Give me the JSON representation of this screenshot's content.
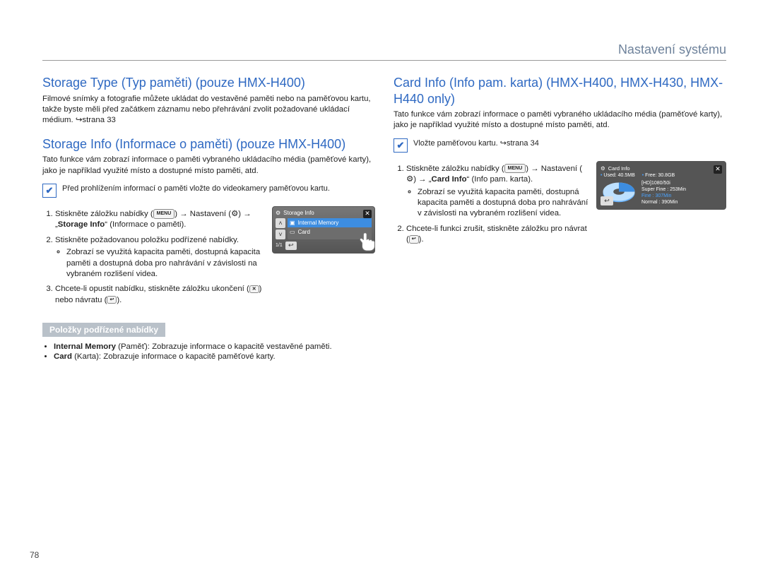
{
  "page_header": "Nastavení systému",
  "page_number": "78",
  "left": {
    "h_storage_type": "Storage Type (Typ paměti) (pouze HMX-H400)",
    "p_storage_type": "Filmové snímky a fotografie můžete ukládat do vestavěné paměti nebo na paměťovou kartu, takže byste měli před začátkem záznamu nebo přehrávání zvolit požadované ukládací médium. ↪strana 33",
    "h_storage_info": "Storage Info (Informace o paměti) (pouze HMX-H400)",
    "p_storage_info": "Tato funkce vám zobrazí informace o paměti vybraného ukládacího média (paměťové karty), jako je například využité místo a dostupné místo paměti, atd.",
    "note": "Před prohlížením informací o paměti vložte do videokamery paměťovou kartu.",
    "step1_a": "Stiskněte záložku nabídky (",
    "step1_b": ") → Nastavení (",
    "step1_c": ") → „",
    "step1_bold": "Storage Info",
    "step1_d": "“ (Informace o paměti).",
    "step2": "Stiskněte požadovanou položku podřízené nabídky.",
    "step2_bullet": "Zobrazí se využitá kapacita paměti, dostupná kapacita paměti a dostupná doba pro nahrávání v závislosti na vybraném rozlišení videa.",
    "step3_a": "Chcete-li opustit nabídku, stiskněte záložku ukončení (",
    "step3_b": ") nebo návratu (",
    "step3_c": ").",
    "sub_h": "Položky podřízené nabídky",
    "item_im_bold": "Internal Memory",
    "item_im_rest": " (Paměť): Zobrazuje informace o kapacitě vestavěné paměti.",
    "item_card_bold": "Card",
    "item_card_rest": " (Karta): Zobrazuje informace o kapacitě paměťové karty.",
    "mini": {
      "title": "Storage Info",
      "row_im": "Internal Memory",
      "row_card": "Card",
      "pager": "1/1"
    }
  },
  "right": {
    "h_card_info": "Card Info (Info pam. karta) (HMX-H400, HMX-H430, HMX-H440 only)",
    "p_card_info": "Tato funkce vám zobrazí informace o paměti vybraného ukládacího média (paměťové karty), jako je například využité místo a dostupné místo paměti, atd.",
    "note": "Vložte paměťovou kartu. ↪strana 34",
    "step1_a": "Stiskněte záložku nabídky (",
    "step1_b": ") → Nastavení (",
    "step1_c": ") → „",
    "step1_bold": "Card Info",
    "step1_d": "“ (Info pam. karta).",
    "step1_bullet": "Zobrazí se využitá kapacita paměti, dostupná kapacita paměti a dostupná doba pro nahrávání v závislosti na vybraném rozlišení videa.",
    "step2_a": "Chcete-li funkci zrušit, stiskněte záložku pro návrat (",
    "step2_b": ").",
    "card": {
      "title": "Card Info",
      "used": "Used: 40.5MB",
      "free": "Free: 30.8GB",
      "mode": "[HD]1080/50i",
      "q1l": "Super Fine",
      "q1v": "253Min",
      "q2l": "Fine",
      "q2v": "307Min",
      "q3l": "Normal",
      "q3v": "390Min"
    }
  },
  "icons": {
    "menu": "MENU",
    "close": "✕",
    "return": "↩"
  }
}
